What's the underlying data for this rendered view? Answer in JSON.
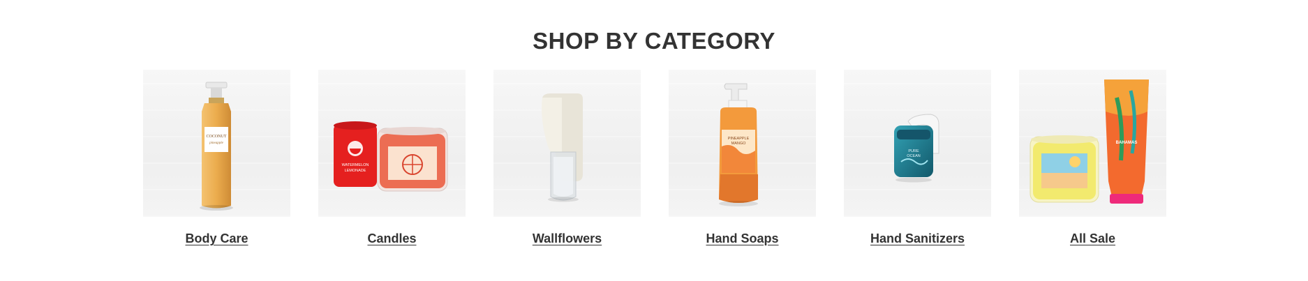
{
  "section": {
    "title": "SHOP BY CATEGORY"
  },
  "categories": [
    {
      "label": "Body Care",
      "image": "fragrance-mist-bottle-image"
    },
    {
      "label": "Candles",
      "image": "candles-image"
    },
    {
      "label": "Wallflowers",
      "image": "wallflower-plug-image"
    },
    {
      "label": "Hand Soaps",
      "image": "foaming-hand-soap-image"
    },
    {
      "label": "Hand Sanitizers",
      "image": "pocketbac-sanitizer-image"
    },
    {
      "label": "All Sale",
      "image": "candle-and-lotion-image"
    }
  ],
  "colors": {
    "text": "#333333",
    "tile_bg": "#f2f2f2"
  }
}
